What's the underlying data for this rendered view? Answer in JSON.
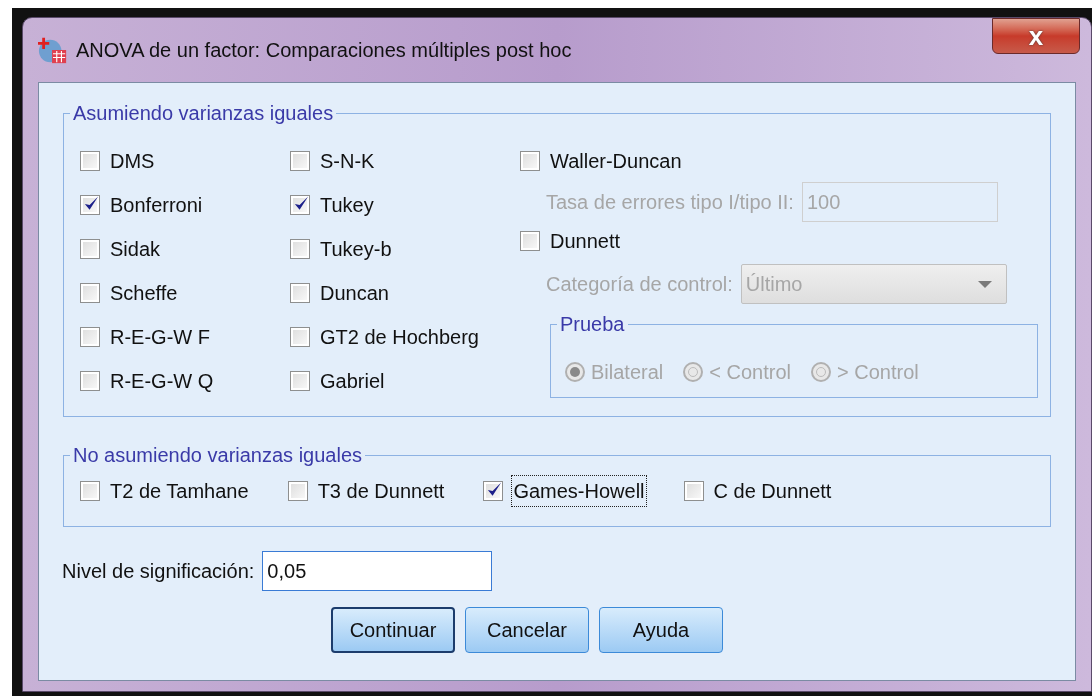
{
  "window": {
    "title": "ANOVA de un factor: Comparaciones múltiples post hoc",
    "close": "x"
  },
  "equal_variances": {
    "title": "Asumiendo varianzas iguales",
    "tests": [
      {
        "label": "DMS",
        "checked": false,
        "focused": false
      },
      {
        "label": "S-N-K",
        "checked": false,
        "focused": false
      },
      {
        "label": "Bonferroni",
        "checked": true,
        "focused": false
      },
      {
        "label": "Tukey",
        "checked": true,
        "focused": false
      },
      {
        "label": "Sidak",
        "checked": false,
        "focused": false
      },
      {
        "label": "Tukey-b",
        "checked": false,
        "focused": false
      },
      {
        "label": "Scheffe",
        "checked": false,
        "focused": false
      },
      {
        "label": "Duncan",
        "checked": false,
        "focused": false
      },
      {
        "label": "R-E-G-W F",
        "checked": false,
        "focused": false
      },
      {
        "label": "GT2 de Hochberg",
        "checked": false,
        "focused": false
      },
      {
        "label": "R-E-G-W Q",
        "checked": false,
        "focused": false
      },
      {
        "label": "Gabriel",
        "checked": false,
        "focused": false
      }
    ],
    "waller_duncan": {
      "label": "Waller-Duncan",
      "checked": false
    },
    "error_rate": {
      "label": "Tasa de errores tipo I/tipo II:",
      "value": "100",
      "disabled": true
    },
    "dunnett": {
      "label": "Dunnett",
      "checked": false
    },
    "control_category": {
      "label": "Categoría de control:",
      "value": "Último",
      "disabled": true
    },
    "test_group": {
      "title": "Prueba",
      "options": [
        {
          "label": "Bilateral",
          "selected": true,
          "disabled": true
        },
        {
          "label": "< Control",
          "selected": false,
          "disabled": true
        },
        {
          "label": "> Control",
          "selected": false,
          "disabled": true
        }
      ]
    }
  },
  "unequal_variances": {
    "title": "No asumiendo varianzas iguales",
    "tests": [
      {
        "label": "T2 de Tamhane",
        "checked": false,
        "focused": false
      },
      {
        "label": "T3 de Dunnett",
        "checked": false,
        "focused": false
      },
      {
        "label": "Games-Howell",
        "checked": true,
        "focused": true
      },
      {
        "label": "C de Dunnett",
        "checked": false,
        "focused": false
      }
    ]
  },
  "significance": {
    "label": "Nivel de significación:",
    "value": "0,05"
  },
  "buttons": [
    {
      "label": "Continuar",
      "default": true
    },
    {
      "label": "Cancelar",
      "default": false
    },
    {
      "label": "Ayuda",
      "default": false
    }
  ]
}
